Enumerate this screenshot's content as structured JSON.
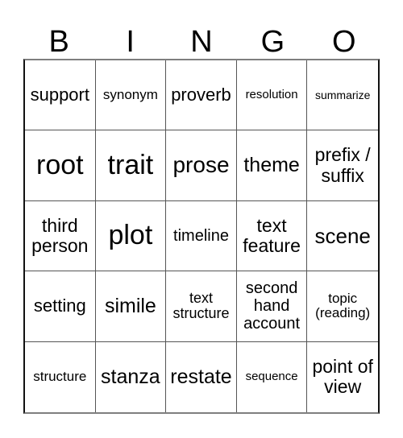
{
  "header": {
    "letters": [
      "B",
      "I",
      "N",
      "G",
      "O"
    ]
  },
  "cells": [
    [
      "support",
      "synonym",
      "proverb",
      "resolution",
      "summarize"
    ],
    [
      "root",
      "trait",
      "prose",
      "theme",
      "prefix / suffix"
    ],
    [
      "third person",
      "plot",
      "timeline",
      "text feature",
      "scene"
    ],
    [
      "setting",
      "simile",
      "text structure",
      "second hand account",
      "topic (reading)"
    ],
    [
      "structure",
      "stanza",
      "restate",
      "sequence",
      "point of view"
    ]
  ]
}
